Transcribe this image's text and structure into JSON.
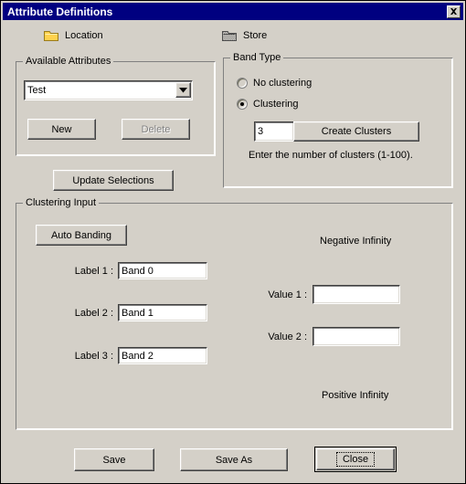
{
  "window": {
    "title": "Attribute Definitions",
    "close_label": "close-icon",
    "bg_color": "#d4d0c8",
    "titlebar_color": "#000080"
  },
  "header": {
    "location": {
      "label": "Location",
      "icon": "folder-icon",
      "icon_state": "enabled",
      "icon_color": "#ffd24d"
    },
    "store": {
      "label": "Store",
      "icon": "folder-icon",
      "icon_state": "disabled",
      "icon_color": "#808080"
    }
  },
  "available_attributes": {
    "title": "Available Attributes",
    "combo": {
      "value": "Test",
      "arrow_icon": "chevron-down-icon"
    },
    "new_button": "New",
    "delete_button": "Delete",
    "delete_enabled": false
  },
  "update_selections_button": "Update Selections",
  "band_type": {
    "title": "Band Type",
    "options": [
      {
        "label": "No clustering",
        "selected": false
      },
      {
        "label": "Clustering",
        "selected": true
      }
    ],
    "cluster_count_value": "3",
    "create_clusters_button": "Create Clusters",
    "hint": "Enter the number of clusters (1-100)."
  },
  "clustering_input": {
    "title": "Clustering Input",
    "auto_banding_button": "Auto Banding",
    "labels": [
      {
        "caption": "Label 1 :",
        "value": "Band 0"
      },
      {
        "caption": "Label 2 :",
        "value": "Band 1"
      },
      {
        "caption": "Label 3 :",
        "value": "Band 2"
      }
    ],
    "negative_infinity": "Negative Infinity",
    "positive_infinity": "Positive Infinity",
    "values": [
      {
        "caption": "Value 1 :",
        "value": ""
      },
      {
        "caption": "Value 2 :",
        "value": ""
      }
    ]
  },
  "footer": {
    "save_button": "Save",
    "save_as_button": "Save As",
    "close_button": "Close",
    "default_button": "Close"
  }
}
